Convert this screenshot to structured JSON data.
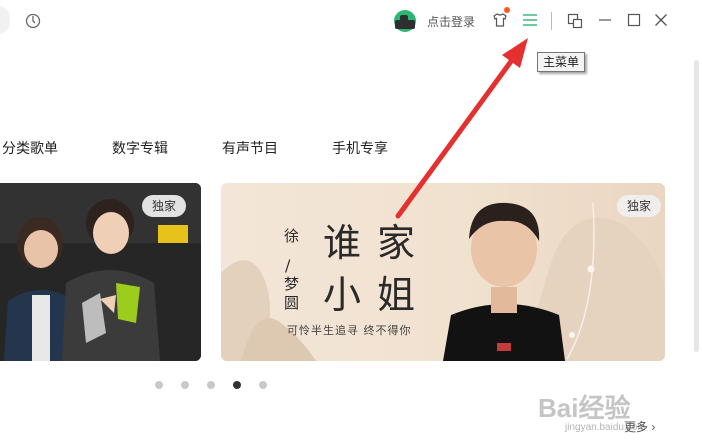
{
  "titlebar": {
    "login_label": "点击登录",
    "tooltip": "主菜单",
    "accent_color": "#2bb673",
    "notify_color": "#ff5a1f"
  },
  "nav": {
    "tabs": [
      {
        "label": "分类歌单"
      },
      {
        "label": "数字专辑"
      },
      {
        "label": "有声节目"
      },
      {
        "label": "手机专享"
      }
    ]
  },
  "banners": {
    "left": {
      "badge": "独家"
    },
    "main": {
      "badge": "独家",
      "title_chars": [
        "谁",
        "家",
        "小",
        "姐"
      ],
      "artist_chars": [
        "徐",
        "梦",
        "圆"
      ],
      "tagline": "可怜半生追寻 终不得你"
    }
  },
  "pager": {
    "count": 5,
    "active_index": 3,
    "more_label": "更多"
  },
  "watermark": {
    "brand": "Bai经验",
    "url": "jingyan.baidu.com"
  },
  "annotation": {
    "arrow_color": "#e53030"
  }
}
